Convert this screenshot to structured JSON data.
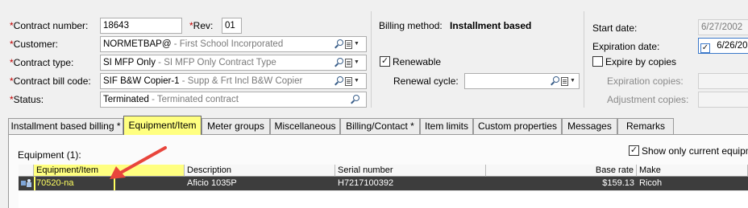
{
  "form": {
    "contract_number": {
      "label": "Contract number:",
      "value": "18643"
    },
    "rev": {
      "label": "Rev:",
      "value": "01"
    },
    "customer": {
      "label": "Customer:",
      "code": "NORMETBAP@",
      "desc": " - First School Incorporated"
    },
    "contract_type": {
      "label": "Contract type:",
      "code": "SI MFP Only",
      "desc": " - SI MFP Only Contract Type"
    },
    "contract_bill_code": {
      "label": "Contract bill code:",
      "code": "SIF B&W Copier-1",
      "desc": " - Supp & Frt Incl B&W Copier"
    },
    "status": {
      "label": "Status:",
      "code": "Terminated",
      "desc": " - Terminated contract"
    },
    "required_mark": "*"
  },
  "billing": {
    "method_label": "Billing method:",
    "method_value": "Installment based",
    "renewable_label": "Renewable",
    "renewable_checked": true,
    "renewal_cycle_label": "Renewal cycle:",
    "renewal_cycle_value": ""
  },
  "dates": {
    "start_label": "Start date:",
    "start_value": "6/27/2002",
    "expiration_label": "Expiration date:",
    "expiration_value": "6/26/20",
    "expiration_checked": true,
    "expire_by_copies_label": "Expire by copies",
    "expire_by_copies_checked": false,
    "expiration_copies_label": "Expiration copies:",
    "adjustment_copies_label": "Adjustment copies:"
  },
  "tabs": [
    {
      "label": "Installment based billing *"
    },
    {
      "label": "Equipment/Item"
    },
    {
      "label": "Meter groups"
    },
    {
      "label": "Miscellaneous"
    },
    {
      "label": "Billing/Contact *"
    },
    {
      "label": "Item limits"
    },
    {
      "label": "Custom properties"
    },
    {
      "label": "Messages"
    },
    {
      "label": "Remarks"
    }
  ],
  "active_tab": "Equipment/Item",
  "equipment": {
    "count_label": "Equipment (1):",
    "show_current_label": "Show only current equipmen",
    "show_current_checked": true,
    "columns": [
      "Equipment/Item",
      "Description",
      "Serial number",
      "Base rate",
      "Make"
    ],
    "rows": [
      {
        "equipment_item": "70520-na",
        "description": "Aficio 1035P",
        "serial_number": "H7217100392",
        "base_rate": "$159.13",
        "make": "Ricoh"
      }
    ]
  },
  "colors": {
    "highlight_yellow": "#ffff80",
    "selected_row_bg": "#3d3d3d",
    "selected_row_text": "#ffffff",
    "highlighted_cell_text": "#ffff60",
    "required_red": "#c00000",
    "annotation_arrow": "#e8453c"
  }
}
